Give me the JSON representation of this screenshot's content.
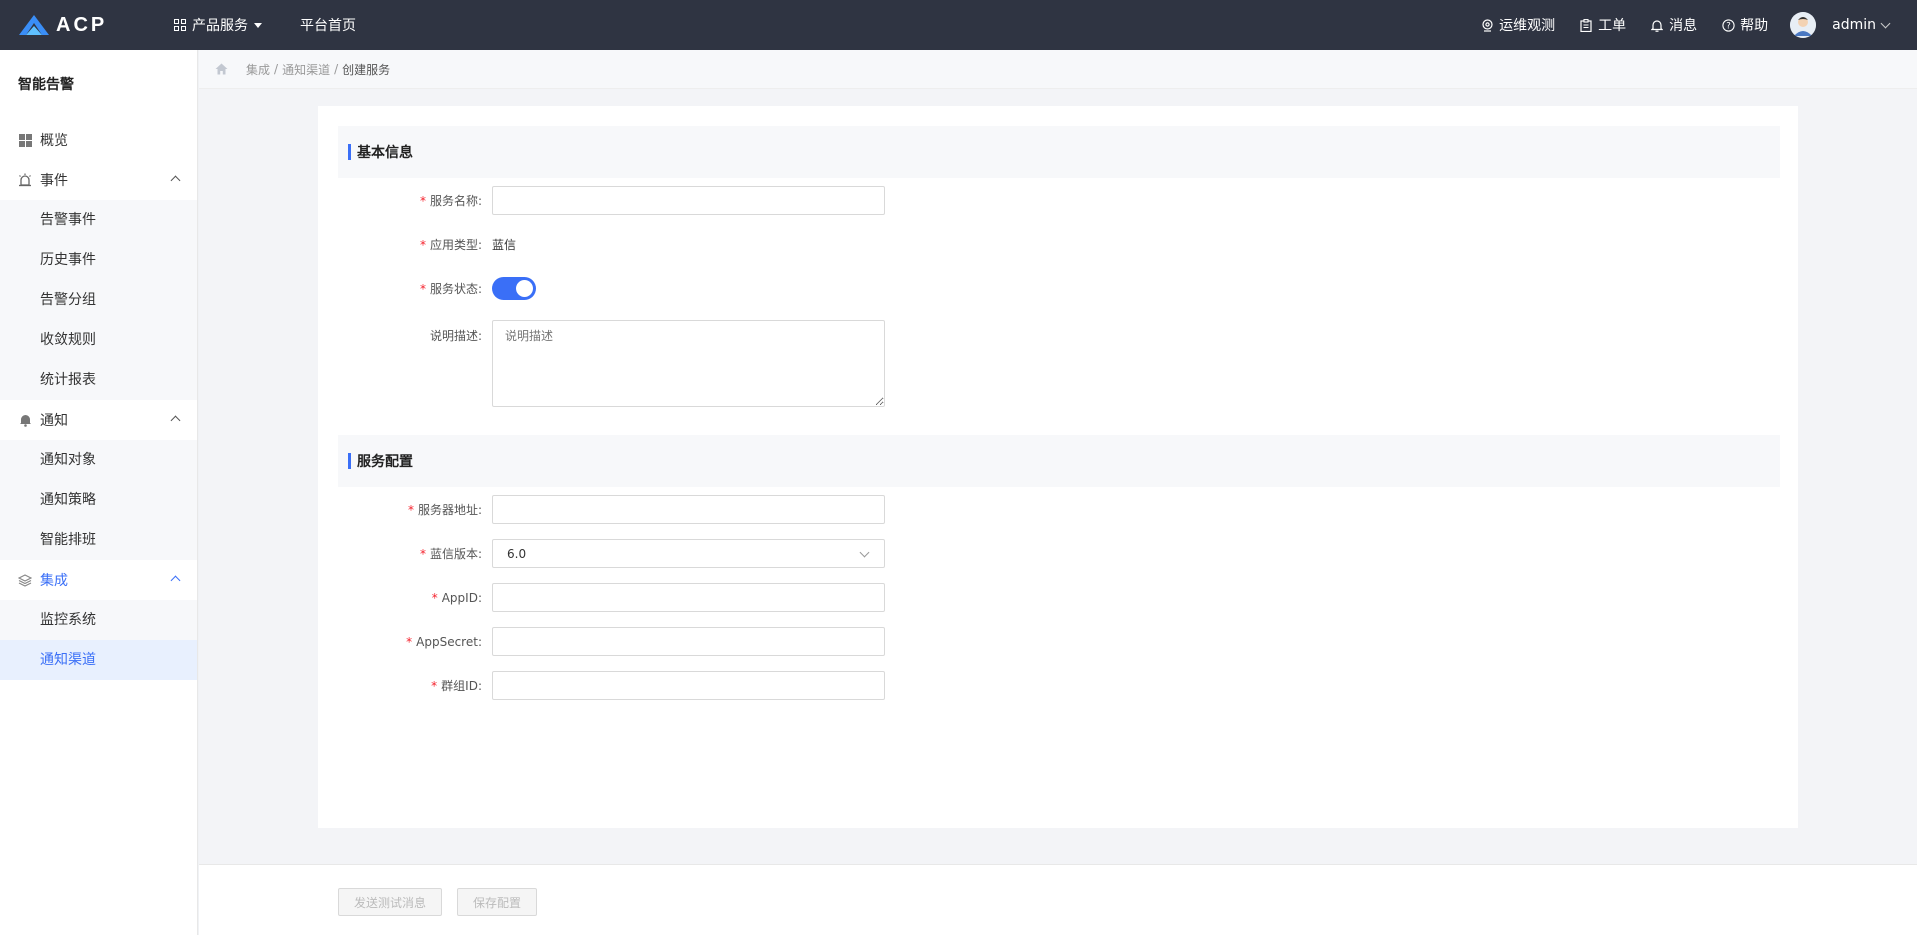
{
  "app": {
    "logo_text": "ACP"
  },
  "topnav": {
    "products_label": "产品服务",
    "home_label": "平台首页",
    "ops_label": "运维观测",
    "ticket_label": "工单",
    "message_label": "消息",
    "help_label": "帮助",
    "user_name": "admin"
  },
  "sidebar": {
    "title": "智能告警",
    "overview": "概览",
    "groups": [
      {
        "label": "事件",
        "items": [
          "告警事件",
          "历史事件",
          "告警分组",
          "收敛规则",
          "统计报表"
        ]
      },
      {
        "label": "通知",
        "items": [
          "通知对象",
          "通知策略",
          "智能排班"
        ]
      },
      {
        "label": "集成",
        "items": [
          "监控系统",
          "通知渠道"
        ]
      }
    ],
    "active_group": "集成",
    "active_item": "通知渠道"
  },
  "breadcrumb": {
    "items": [
      "集成",
      "通知渠道"
    ],
    "current": "创建服务"
  },
  "form": {
    "basic_section": "基本信息",
    "service_name_label": "服务名称",
    "service_name_value": "",
    "app_type_label": "应用类型",
    "app_type_value": "蓝信",
    "status_label": "服务状态",
    "status_on": true,
    "desc_label": "说明描述",
    "desc_placeholder": "说明描述",
    "config_section": "服务配置",
    "server_addr_label": "服务器地址",
    "server_addr_value": "",
    "version_label": "蓝信版本",
    "version_value": "6.0",
    "appid_label": "AppID",
    "appid_value": "",
    "appsecret_label": "AppSecret",
    "appsecret_value": "",
    "groupid_label": "群组ID",
    "groupid_value": ""
  },
  "footer": {
    "test_button": "发送测试消息",
    "save_button": "保存配置"
  },
  "colors": {
    "topbar": "#2f3442",
    "accent": "#3a6ff7",
    "required": "#f5222d"
  }
}
